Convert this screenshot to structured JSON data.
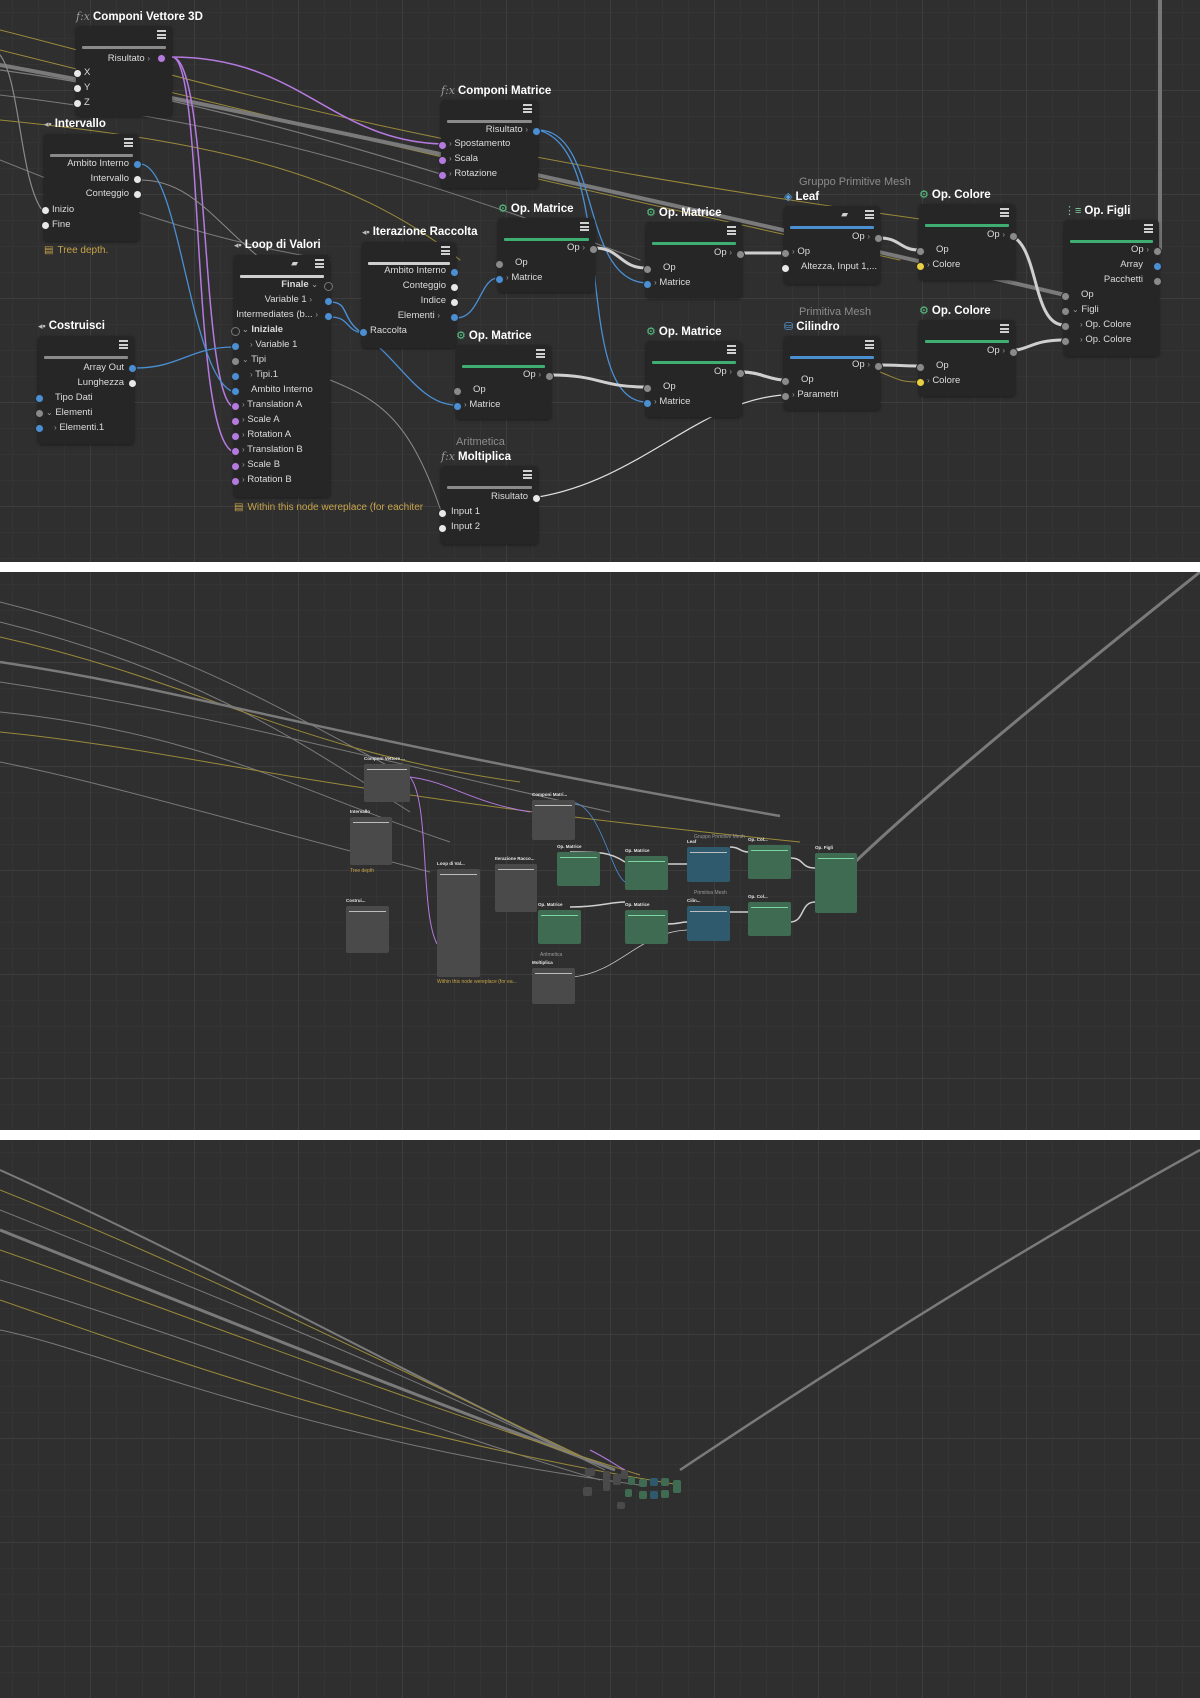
{
  "colors": {
    "canvas": "#2f2f2f",
    "node": "#262626",
    "purple": "#b57ae0",
    "blue": "#4a8fd4",
    "green": "#3fae72",
    "yellow": "#e8d040",
    "comment": "#c7a44a"
  },
  "nodes": {
    "componi_vettore": {
      "title": "Componi Vettore 3D",
      "icon": "fx-icon",
      "out": "Risultato",
      "in": [
        "X",
        "Y",
        "Z"
      ]
    },
    "intervallo": {
      "title": "Intervallo",
      "out": [
        "Ambito Interno",
        "Intervallo",
        "Conteggio"
      ],
      "in": [
        "Inizio",
        "Fine"
      ]
    },
    "comment_tree": "Tree depth.",
    "costruisci": {
      "title": "Costruisci",
      "out": [
        "Array Out",
        "Lunghezza"
      ],
      "in": [
        "Tipo Dati",
        "Elementi",
        "Elementi.1"
      ]
    },
    "loop": {
      "title": "Loop di Valori",
      "finale": "Finale",
      "var1": "Variable 1",
      "intermediates": "Intermediates (b...",
      "iniziale": "Iniziale",
      "var1b": "Variable 1",
      "tipi": "Tipi",
      "tipi1": "Tipi.1",
      "ambito": "Ambito Interno",
      "inputs": [
        "Translation A",
        "Scale A",
        "Rotation A",
        "Translation B",
        "Scale B",
        "Rotation B"
      ]
    },
    "comment_loop": "Within this node wereplace (for eachiter",
    "iterazione": {
      "title": "Iterazione Raccolta",
      "out": [
        "Ambito Interno",
        "Conteggio",
        "Indice",
        "Elementi"
      ],
      "in": "Raccolta"
    },
    "componi_matrice": {
      "title": "Componi Matrice",
      "out": "Risultato",
      "in": [
        "Spostamento",
        "Scala",
        "Rotazione"
      ]
    },
    "moltiplica": {
      "sub": "Aritmetica",
      "title": "Moltiplica",
      "out": "Risultato",
      "in": [
        "Input 1",
        "Input 2"
      ]
    },
    "op_matrice_1": {
      "title": "Op. Matrice",
      "out": "Op",
      "in": [
        "Op",
        "Matrice"
      ]
    },
    "op_matrice_2": {
      "title": "Op. Matrice",
      "out": "Op",
      "in": [
        "Op",
        "Matrice"
      ]
    },
    "op_matrice_3": {
      "title": "Op. Matrice",
      "out": "Op",
      "in": [
        "Op",
        "Matrice"
      ]
    },
    "op_matrice_4": {
      "title": "Op. Matrice",
      "out": "Op",
      "in": [
        "Op",
        "Matrice"
      ]
    },
    "leaf": {
      "sub": "Gruppo Primitive Mesh",
      "title": "Leaf",
      "out": "Op",
      "in": [
        "Op",
        "Altezza, Input 1,..."
      ]
    },
    "cilindro": {
      "sub": "Primitiva Mesh",
      "title": "Cilindro",
      "out": "Op",
      "in": [
        "Op",
        "Parametri"
      ]
    },
    "op_colore_1": {
      "title": "Op. Colore",
      "out": "Op",
      "in": [
        "Op",
        "Colore"
      ]
    },
    "op_colore_2": {
      "title": "Op. Colore",
      "out": "Op",
      "in": [
        "Op",
        "Colore"
      ]
    },
    "op_figli": {
      "title": "Op. Figli",
      "out": [
        "Op",
        "Array",
        "Pacchetti"
      ],
      "in": [
        "Op",
        "Figli",
        "Op. Colore",
        "Op. Colore"
      ]
    }
  },
  "mini": {
    "componi_vettore": "Componi Vettore ...",
    "intervallo": "Intervallo",
    "costruisci": "Costrui...",
    "loop": "Loop di Val...",
    "iterazione": "Iterazione Racco...",
    "componi_matrice": "Componi Matri...",
    "op_matrice": "Op. Matrice",
    "leaf": "Leaf",
    "cilindro": "Cilin...",
    "op_colore": "Op. Col...",
    "op_figli": "Op. Figli",
    "gruppo": "Gruppo Primitive Mesh",
    "primitiva": "Primitiva Mesh",
    "aritmetica": "Aritmetica",
    "moltiplica": "Moltiplica",
    "tree": "Tree depth",
    "loop_comment": "Within this node wereplace (for ea..."
  }
}
